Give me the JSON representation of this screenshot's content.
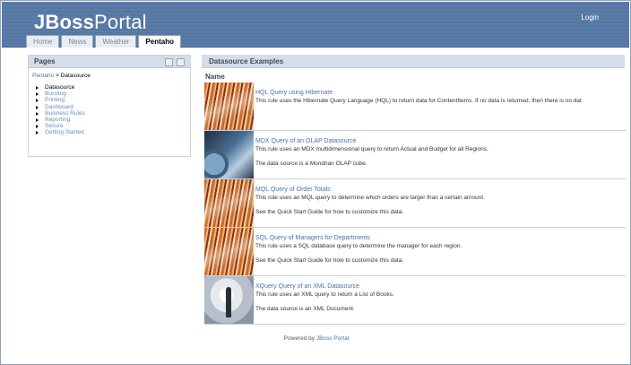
{
  "header": {
    "logo_bold": "JBoss",
    "logo_light": "Portal",
    "login_label": "Login"
  },
  "tabs": [
    {
      "label": "Home"
    },
    {
      "label": "News"
    },
    {
      "label": "Weather"
    },
    {
      "label": "Pentaho"
    }
  ],
  "pages_panel": {
    "title": "Pages",
    "breadcrumb_link": "Pentaho",
    "breadcrumb_sep": ">",
    "breadcrumb_current": "Datasource",
    "items": [
      {
        "label": "Datasource"
      },
      {
        "label": "Bursting"
      },
      {
        "label": "Printing"
      },
      {
        "label": "Dashboard"
      },
      {
        "label": "Business Rules"
      },
      {
        "label": "Reporting"
      },
      {
        "label": "Secure"
      },
      {
        "label": "Getting Started"
      }
    ]
  },
  "datasource_panel": {
    "title": "Datasource Examples",
    "column_header": "Name",
    "rows": [
      {
        "title": "HQL Query using Hibernate",
        "desc": "This rule uses the Hibernate Query Language (HQL) to return data for ContentItems. If no data is returned, then there is no dat",
        "desc2": "",
        "thumb": "filing-drawers-image"
      },
      {
        "title": "MDX Query of an OLAP Datasource",
        "desc": "This rule uses an MDX multidimensional query to return Actual and Budget for all Regions.",
        "desc2": "The data source is a Mondrian OLAP cube.",
        "thumb": "globe-image"
      },
      {
        "title": "MQL Query of Order Totals",
        "desc": "This rule uses an MQL query to determine which orders are larger than a certain amount.",
        "desc2": "See the Quick Start Guide for how to customize this data.",
        "thumb": "filing-drawers-image"
      },
      {
        "title": "SQL Query of Managers for Departments",
        "desc": "This rule uses a SQL database query to determine the manager for each region.",
        "desc2": "See the Quick Start Guide for how to customize this data.",
        "thumb": "filing-drawers-image"
      },
      {
        "title": "XQuery Query of an XML Datasource",
        "desc": "This rule uses an XML query to return a List of Books.",
        "desc2": "The data source is an XML Document.",
        "thumb": "person-image"
      }
    ]
  },
  "footer": {
    "prefix": "Powered by",
    "link": "JBoss Portal"
  },
  "colors": {
    "header_blue": "#5a7ca6",
    "link_blue": "#4a73a6",
    "panel_header": "#d4dde8"
  }
}
